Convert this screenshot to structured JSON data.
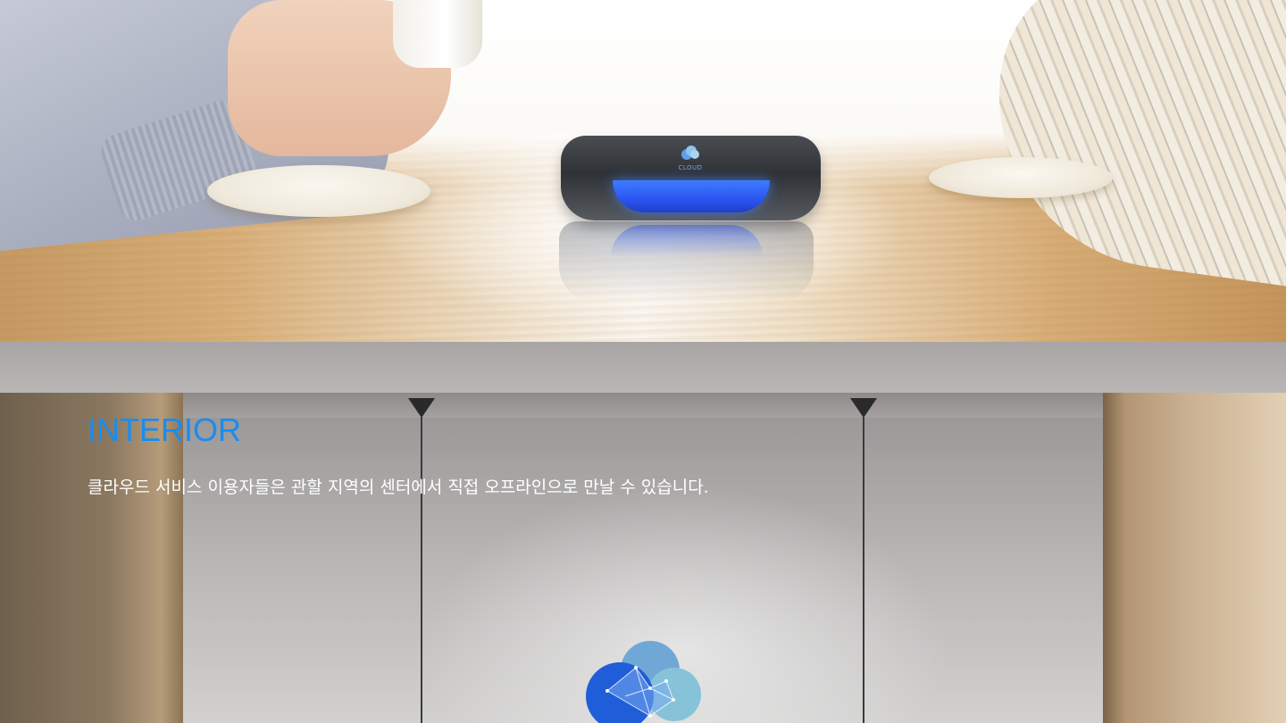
{
  "hero": {
    "device_brand": "CLOUD"
  },
  "interior": {
    "heading": "INTERIOR",
    "description": "클라우드 서비스 이용자들은 관할 지역의 센터에서 직접 오프라인으로 만날 수 있습니다."
  },
  "colors": {
    "heading": "#1a8cf0",
    "description": "#ffffff",
    "device_panel": "#2a55f0"
  },
  "icons": {
    "device_logo": "cloud-icon",
    "wall_logo": "cloud-logo-icon"
  }
}
